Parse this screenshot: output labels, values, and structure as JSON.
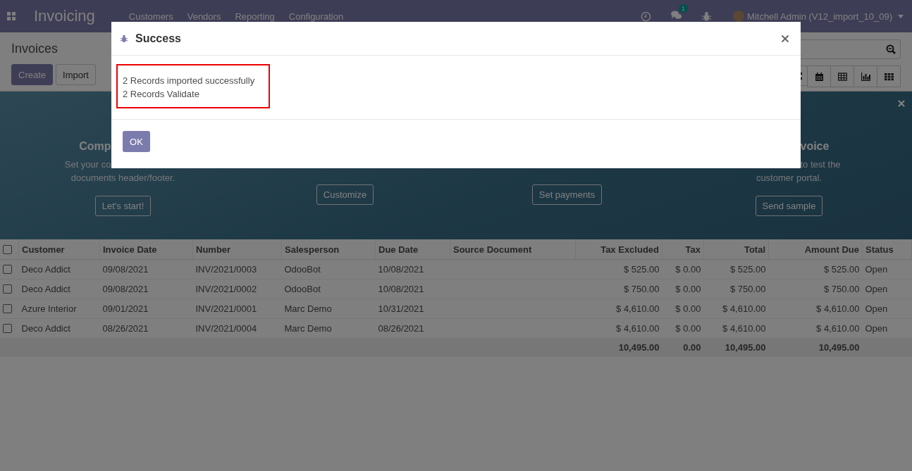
{
  "navbar": {
    "app_name": "Invoicing",
    "menu": [
      "Customers",
      "Vendors",
      "Reporting",
      "Configuration"
    ],
    "chat_badge": "1",
    "user": "Mitchell Admin (V12_import_10_09)"
  },
  "control_panel": {
    "breadcrumb": "Invoices",
    "buttons": [
      {
        "label": "Create",
        "kind": "primary"
      },
      {
        "label": "Import",
        "kind": "secondary"
      }
    ]
  },
  "banner": {
    "columns": [
      {
        "title": {
          "text": "Comp",
          "cut": true
        },
        "lines": [
          {
            "text": "Set your co",
            "cut": true
          },
          {
            "text": "documents header/footer."
          }
        ],
        "button": "Let's start!"
      },
      {
        "button": "Customize"
      },
      {
        "button": "Set payments"
      },
      {
        "title": {
          "text": "voice",
          "cut": true
        },
        "lines": [
          {
            "text": "to test the",
            "cut": true
          },
          {
            "text": "customer portal."
          }
        ],
        "button": "Send sample"
      }
    ]
  },
  "table": {
    "header_checked": false,
    "columns": [
      {
        "label": "Customer",
        "numeric": false
      },
      {
        "label": "Invoice Date",
        "numeric": false
      },
      {
        "label": "Number",
        "numeric": false
      },
      {
        "label": "Salesperson",
        "numeric": false
      },
      {
        "label": "Due Date",
        "numeric": false
      },
      {
        "label": "Source Document",
        "numeric": false
      },
      {
        "label": "Tax Excluded",
        "numeric": true,
        "total": "10,495.00"
      },
      {
        "label": "Tax",
        "numeric": true,
        "total": "0.00"
      },
      {
        "label": "Total",
        "numeric": true,
        "total": "10,495.00"
      },
      {
        "label": "Amount Due",
        "numeric": true,
        "total": "10,495.00"
      },
      {
        "label": "Status",
        "numeric": false
      }
    ],
    "rows": [
      {
        "checked": false,
        "cells": [
          "Deco Addict",
          "09/08/2021",
          "INV/2021/0003",
          "OdooBot",
          "10/08/2021",
          null,
          "$ 525.00",
          "$ 0.00",
          "$ 525.00",
          "$ 525.00",
          "Open"
        ]
      },
      {
        "checked": false,
        "cells": [
          "Deco Addict",
          "09/08/2021",
          "INV/2021/0002",
          "OdooBot",
          "10/08/2021",
          null,
          "$ 750.00",
          "$ 0.00",
          "$ 750.00",
          "$ 750.00",
          "Open"
        ]
      },
      {
        "checked": false,
        "cells": [
          "Azure Interior",
          "09/01/2021",
          "INV/2021/0001",
          "Marc Demo",
          "10/31/2021",
          null,
          "$ 4,610.00",
          "$ 0.00",
          "$ 4,610.00",
          "$ 4,610.00",
          "Open"
        ]
      },
      {
        "checked": false,
        "cells": [
          "Deco Addict",
          "08/26/2021",
          "INV/2021/0004",
          "Marc Demo",
          "08/26/2021",
          null,
          "$ 4,610.00",
          "$ 0.00",
          "$ 4,610.00",
          "$ 4,610.00",
          "Open"
        ]
      }
    ]
  },
  "dialog": {
    "title": "Success",
    "messages": [
      "2 Records imported successfully",
      "2 Records Validate"
    ],
    "ok_button": "OK"
  }
}
